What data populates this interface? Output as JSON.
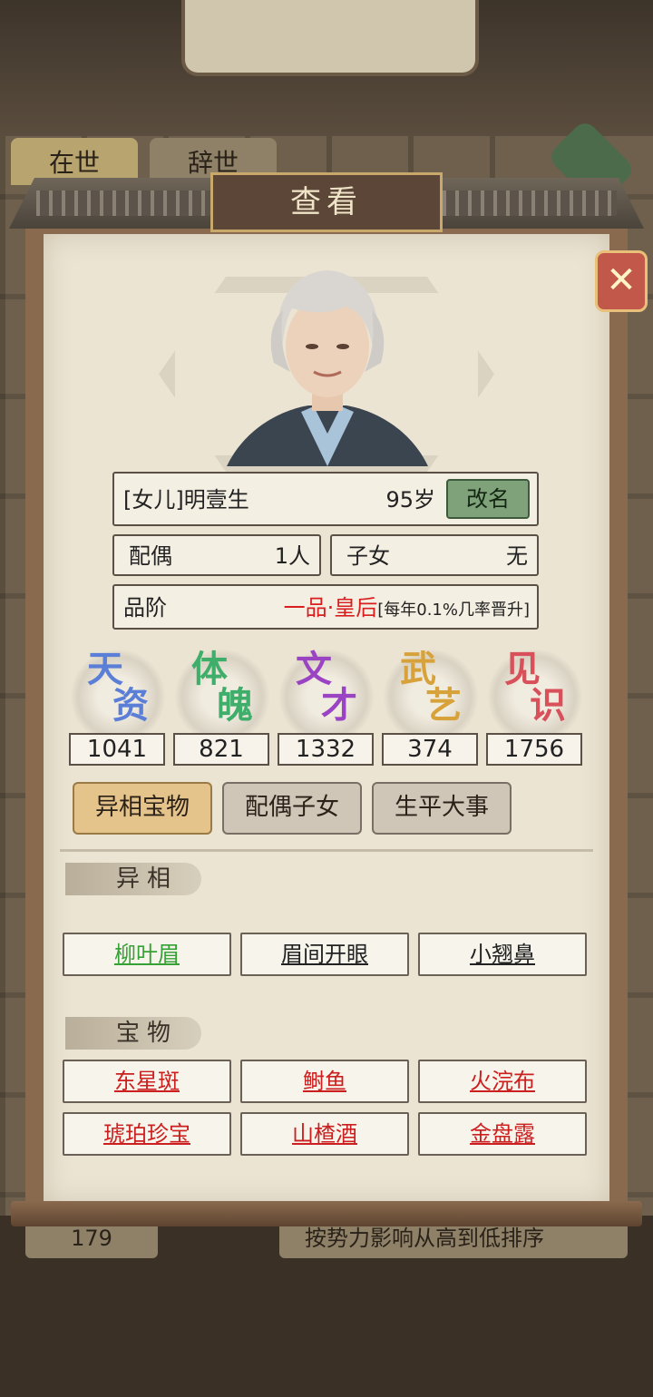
{
  "background": {
    "tabs": [
      "在世",
      "辞世"
    ],
    "pager": "179",
    "sort_hint": "按势力影响从高到低排序"
  },
  "dialog": {
    "title": "查看",
    "close_icon": "close-x-icon"
  },
  "person": {
    "name": "[女儿]明壹生",
    "age": "95岁",
    "rename_label": "改名",
    "spouse_label": "配偶",
    "spouse_value": "1人",
    "children_label": "子女",
    "children_value": "无",
    "rank_label": "品阶",
    "rank_value": "一品·皇后",
    "rank_note": "[每年0.1%几率晋升]"
  },
  "stats": [
    {
      "l1": "天",
      "l2": "资",
      "value": "1041",
      "color": "#5b7fd6"
    },
    {
      "l1": "体",
      "l2": "魄",
      "value": "821",
      "color": "#3fae6a"
    },
    {
      "l1": "文",
      "l2": "才",
      "value": "1332",
      "color": "#9a44c4"
    },
    {
      "l1": "武",
      "l2": "艺",
      "value": "374",
      "color": "#d8a23a"
    },
    {
      "l1": "见",
      "l2": "识",
      "value": "1756",
      "color": "#d8505a"
    }
  ],
  "tabs": [
    "异相宝物",
    "配偶子女",
    "生平大事"
  ],
  "sections": {
    "traits_title": "异相",
    "traits": [
      "柳叶眉",
      "眉间开眼",
      "小翘鼻"
    ],
    "treasures_title": "宝物",
    "treasures": [
      "东星斑",
      "鲥鱼",
      "火浣布",
      "琥珀珍宝",
      "山楂酒",
      "金盘露"
    ]
  }
}
